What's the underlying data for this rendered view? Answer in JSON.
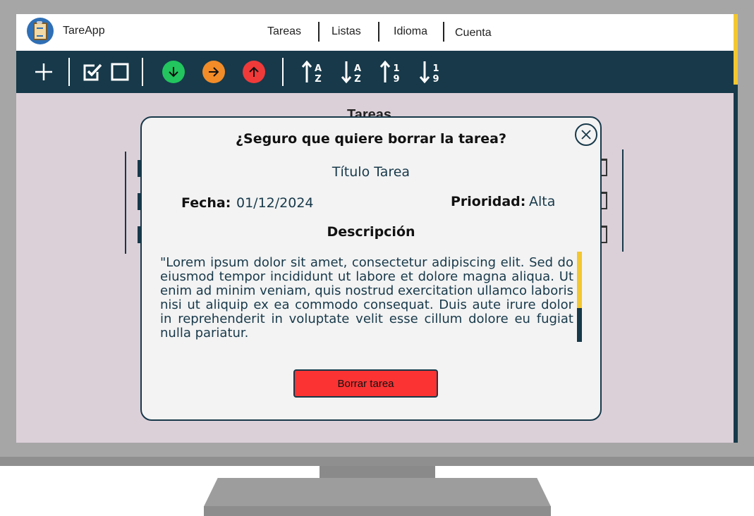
{
  "app": {
    "name": "TareApp",
    "logo_icon": "clipboard-icon"
  },
  "nav": {
    "items": [
      "Tareas",
      "Listas",
      "Idioma",
      "Cuenta"
    ]
  },
  "toolbar": {
    "buttons": [
      {
        "name": "add-icon"
      },
      {
        "name": "checkbox-checked-icon"
      },
      {
        "name": "checkbox-empty-icon"
      },
      {
        "name": "priority-low-icon",
        "color": "#22c55e"
      },
      {
        "name": "priority-medium-icon",
        "color": "#f28c28"
      },
      {
        "name": "priority-high-icon",
        "color": "#f03a3a"
      },
      {
        "name": "sort-alpha-asc-icon",
        "label_top": "A",
        "label_bottom": "Z"
      },
      {
        "name": "sort-alpha-desc-icon",
        "label_top": "A",
        "label_bottom": "Z"
      },
      {
        "name": "sort-num-asc-icon",
        "label_top": "1",
        "label_bottom": "9"
      },
      {
        "name": "sort-num-desc-icon",
        "label_top": "1",
        "label_bottom": "9"
      }
    ]
  },
  "background": {
    "title": "Tareas"
  },
  "modal": {
    "title": "¿Seguro que quiere borrar la tarea?",
    "task_title": "Título Tarea",
    "date_label": "Fecha:",
    "date_value": "01/12/2024",
    "priority_label": "Prioridad:",
    "priority_value": "Alta",
    "description_label": "Descripción",
    "description": "\"Lorem ipsum dolor sit amet, consectetur adipiscing elit. Sed do eiusmod tempor incididunt ut labore et dolore magna aliqua. Ut enim ad minim veniam, quis nostrud exercitation ullamco laboris nisi ut aliquip ex ea commodo consequat. Duis aute irure dolor in reprehenderit in voluptate velit esse cillum dolore eu fugiat nulla pariatur.",
    "delete_button": "Borrar tarea",
    "close_icon": "close-icon"
  },
  "colors": {
    "primary": "#17394a",
    "background": "#dcd0d8",
    "accent": "#f3c730",
    "danger": "#fb3333",
    "monitor": "#a6a6a6"
  }
}
